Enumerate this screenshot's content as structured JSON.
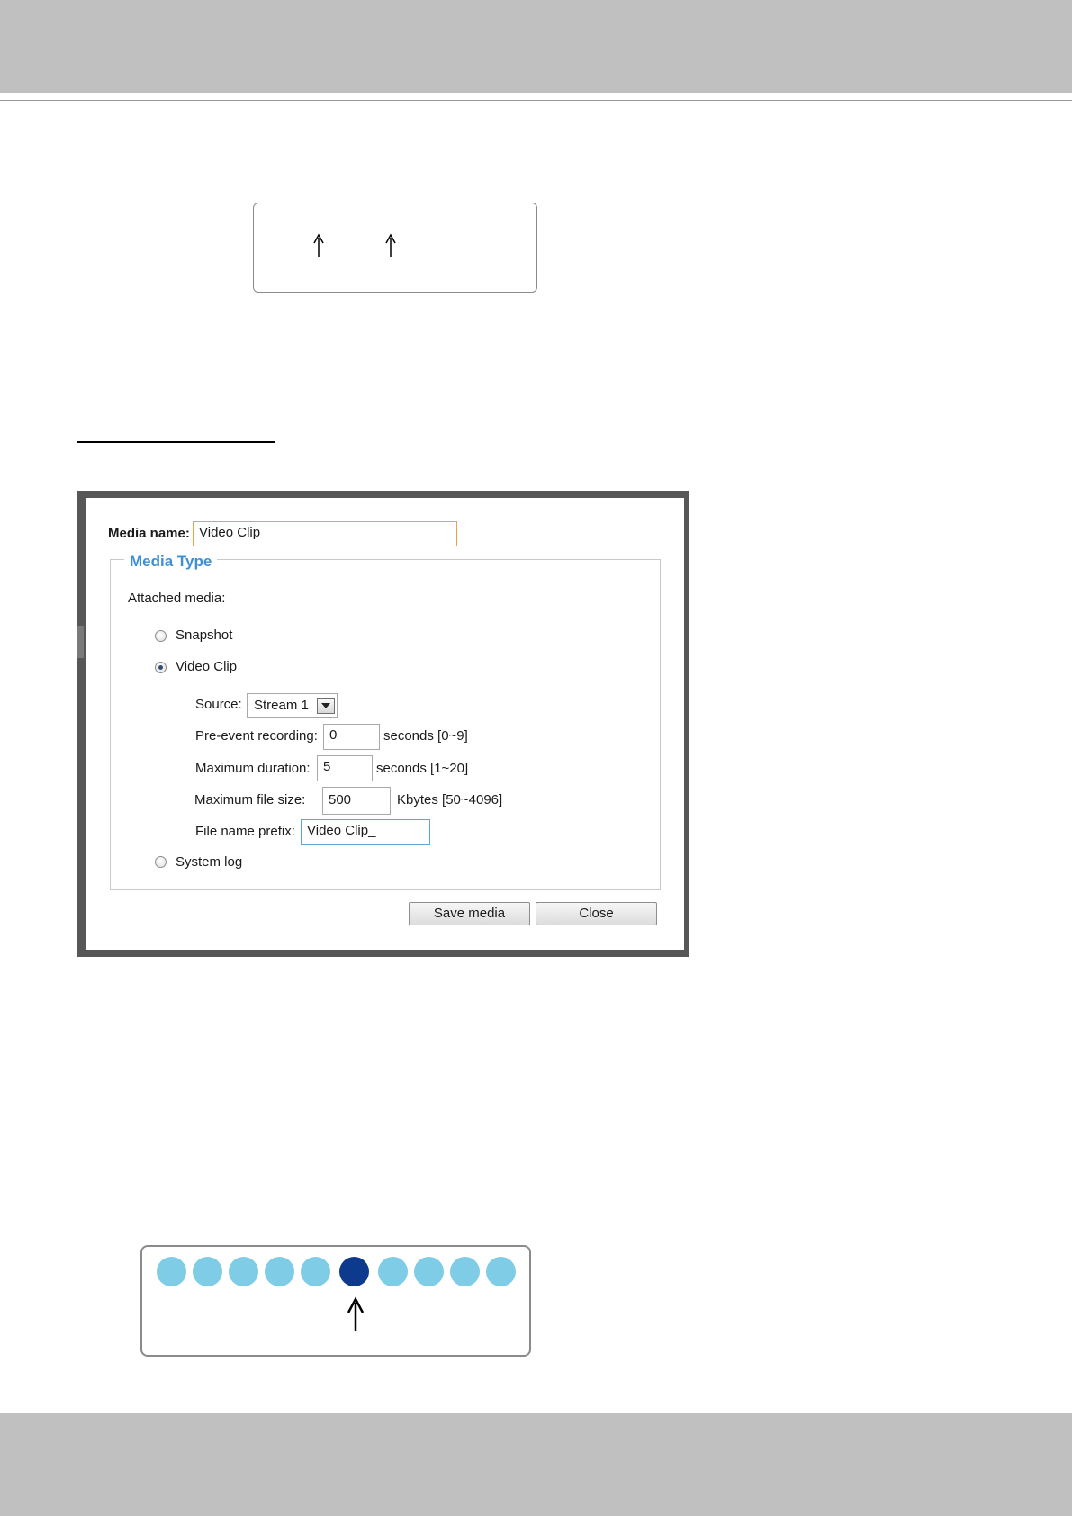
{
  "dialog": {
    "media_name_label": "Media name:",
    "media_name_value": "Video Clip",
    "media_type_legend": "Media Type",
    "attached_media_label": "Attached media:",
    "options": {
      "snapshot": {
        "label": "Snapshot",
        "checked": false
      },
      "video_clip": {
        "label": "Video Clip",
        "checked": true
      },
      "system_log": {
        "label": "System log",
        "checked": false
      }
    },
    "source_label": "Source:",
    "source_value": "Stream 1",
    "pre_event_label": "Pre-event recording:",
    "pre_event_value": "0",
    "pre_event_unit": "seconds [0~9]",
    "max_duration_label": "Maximum duration:",
    "max_duration_value": "5",
    "max_duration_unit": "seconds [1~20]",
    "max_file_size_label": "Maximum file size:",
    "max_file_size_value": "500",
    "max_file_size_unit": "Kbytes [50~4096]",
    "file_prefix_label": "File name prefix:",
    "file_prefix_value": "Video Clip_",
    "save_button": "Save media",
    "close_button": "Close"
  },
  "indicator": {
    "dot_count": 10,
    "active_index": 5
  },
  "colors": {
    "dot_inactive": "#7ecce6",
    "dot_active": "#0d3a8c",
    "legend": "#3d8fd6",
    "media_name_border": "#e8a24a",
    "prefix_border": "#5aa7d8"
  }
}
